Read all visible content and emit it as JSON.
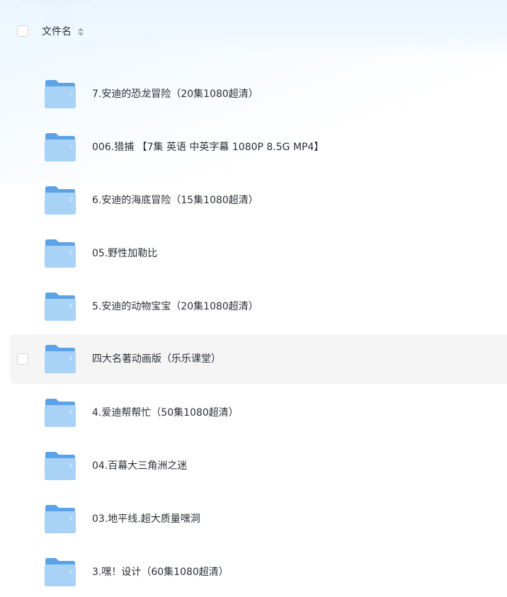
{
  "header": {
    "file_name_label": "文件名"
  },
  "files": [
    {
      "name": ""
    },
    {
      "name": "7.安迪的恐龙冒险（20集1080超清）"
    },
    {
      "name": "006.猎捕 【7集 英语 中英字幕 1080P 8.5G MP4】"
    },
    {
      "name": "6.安迪的海底冒险（15集1080超清）"
    },
    {
      "name": "05.野性加勒比"
    },
    {
      "name": "5.安迪的动物宝宝（20集1080超清）"
    },
    {
      "name": "四大名著动画版（乐乐课堂）",
      "hovered": true
    },
    {
      "name": "4.爱迪帮帮忙（50集1080超清）"
    },
    {
      "name": "04.百幕大三角洲之迷"
    },
    {
      "name": "03.地平线.超大质量嘿洞"
    },
    {
      "name": "3.嘿！设计（60集1080超清）"
    }
  ],
  "colors": {
    "folder_back": "#5ba3e6",
    "folder_front": "#a9d2f7",
    "hover_row": "#f5f5f6"
  }
}
